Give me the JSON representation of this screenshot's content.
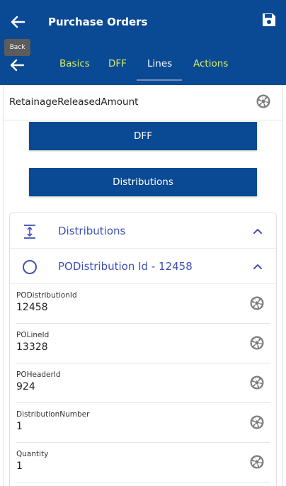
{
  "header": {
    "title": "Purchase Orders",
    "back_tooltip": "Back"
  },
  "tabs": [
    {
      "label": "Basics",
      "active": false
    },
    {
      "label": "DFF",
      "active": false
    },
    {
      "label": "Lines",
      "active": true
    },
    {
      "label": "Actions",
      "active": false
    }
  ],
  "top_field": {
    "label": "RetainageReleasedAmount"
  },
  "buttons": {
    "dff": "DFF",
    "distributions": "Distributions"
  },
  "distributions_section": {
    "label": "Distributions"
  },
  "distribution_item": {
    "label": "PODistribution Id - 12458"
  },
  "fields": [
    {
      "label": "PODistributionId",
      "value": "12458"
    },
    {
      "label": "POLineId",
      "value": "13328"
    },
    {
      "label": "POHeaderId",
      "value": "924"
    },
    {
      "label": "DistributionNumber",
      "value": "1"
    },
    {
      "label": "Quantity",
      "value": "1"
    }
  ],
  "colors": {
    "primary": "#0a4a94",
    "tab_accent": "#d7ef63",
    "section_text": "#3f51b5"
  }
}
